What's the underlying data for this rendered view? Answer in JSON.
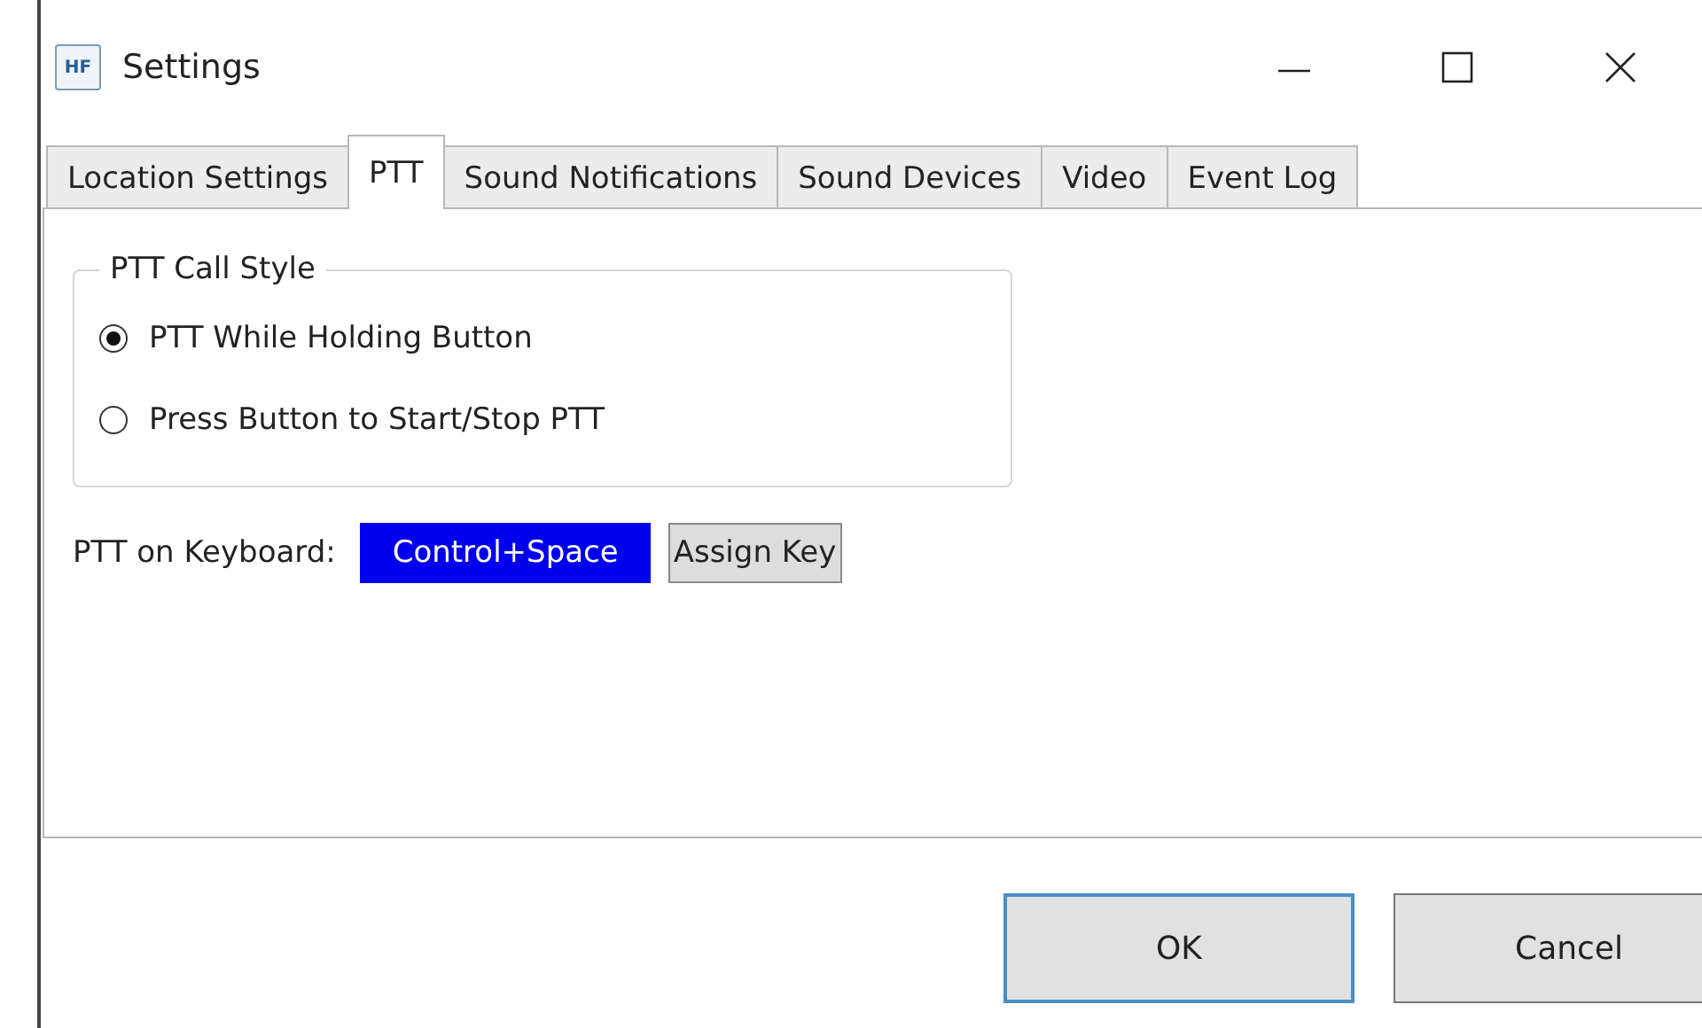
{
  "window": {
    "icon_text": "HF",
    "title": "Settings",
    "controls": [
      {
        "kind": "minimize"
      },
      {
        "kind": "maximize"
      },
      {
        "kind": "close"
      }
    ]
  },
  "tabs": [
    {
      "label": "Location Settings",
      "selected": false
    },
    {
      "label": "PTT",
      "selected": true
    },
    {
      "label": "Sound Notifications",
      "selected": false
    },
    {
      "label": "Sound Devices",
      "selected": false
    },
    {
      "label": "Video",
      "selected": false
    },
    {
      "label": "Event Log",
      "selected": false
    }
  ],
  "call_style": {
    "title": "PTT Call Style",
    "options": [
      {
        "label": "PTT While Holding Button",
        "selected": true
      },
      {
        "label": "Press Button to Start/Stop PTT",
        "selected": false
      }
    ]
  },
  "keyboard": {
    "label": "PTT on Keyboard:",
    "key": "Control+Space",
    "assign_button": "Assign Key"
  },
  "buttons": [
    {
      "label": "OK",
      "focused": true
    },
    {
      "label": "Cancel",
      "focused": false
    }
  ]
}
